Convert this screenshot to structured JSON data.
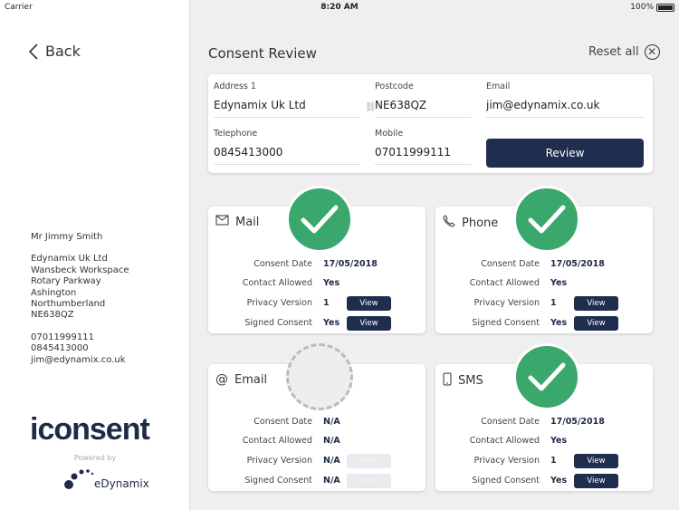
{
  "status": {
    "carrier": "Carrier",
    "time": "8:20 AM",
    "battery": "100%"
  },
  "sidebar": {
    "back": "Back",
    "name": "Mr Jimmy Smith",
    "address": [
      "Edynamix Uk Ltd",
      "Wansbeck Workspace",
      "Rotary Parkway",
      "Ashington",
      "Northumberland",
      "NE638QZ"
    ],
    "phones": [
      "07011999111",
      "0845413000",
      "jim@edynamix.co.uk"
    ],
    "logo": "iconsent",
    "powered": "Powered by",
    "brand": "eDynamix"
  },
  "header": {
    "title": "Consent Review",
    "reset": "Reset all"
  },
  "form": {
    "address1": {
      "label": "Address 1",
      "value": "Edynamix Uk Ltd"
    },
    "postcode": {
      "label": "Postcode",
      "value": "NE638QZ"
    },
    "email": {
      "label": "Email",
      "value": "jim@edynamix.co.uk"
    },
    "telephone": {
      "label": "Telephone",
      "value": "0845413000"
    },
    "mobile": {
      "label": "Mobile",
      "value": "07011999111"
    },
    "review": "Review"
  },
  "labels": {
    "date": "Consent Date",
    "allowed": "Contact Allowed",
    "privacy": "Privacy Version",
    "signed": "Signed Consent",
    "view": "View"
  },
  "colors": {
    "accent": "#1f2d4e",
    "success": "#3aa76d"
  },
  "cards": [
    {
      "title": "Mail",
      "icon": "envelope-icon",
      "status": "consented",
      "date": "17/05/2018",
      "allowed": "Yes",
      "privacy": "1",
      "signed": "Yes"
    },
    {
      "title": "Phone",
      "icon": "phone-icon",
      "status": "consented",
      "date": "17/05/2018",
      "allowed": "Yes",
      "privacy": "1",
      "signed": "Yes"
    },
    {
      "title": "Email",
      "icon": "at-icon",
      "status": "pending",
      "date": "N/A",
      "allowed": "N/A",
      "privacy": "N/A",
      "signed": "N/A"
    },
    {
      "title": "SMS",
      "icon": "mobile-icon",
      "status": "consented",
      "date": "17/05/2018",
      "allowed": "Yes",
      "privacy": "1",
      "signed": "Yes"
    }
  ]
}
